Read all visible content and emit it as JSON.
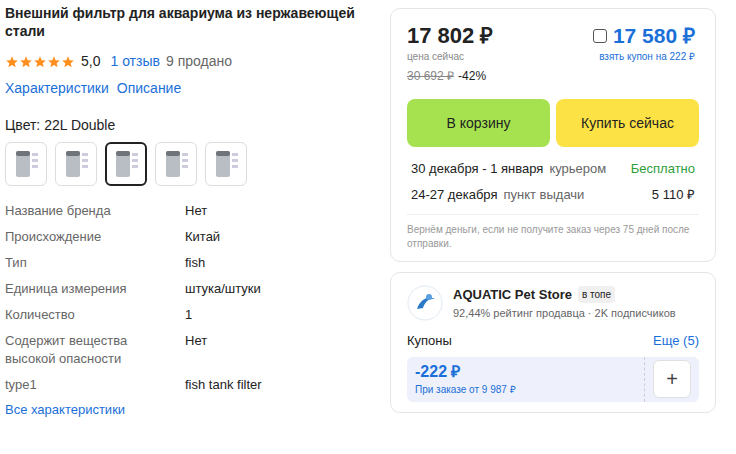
{
  "product": {
    "title": "Внешний фильтр для аквариума из нержавеющей стали",
    "stars": 5,
    "rating": "5,0",
    "reviews": "1 отзыв",
    "sold": "9 продано",
    "links": [
      "Характеристики",
      "Описание"
    ],
    "color_label": "Цвет: 22L Double",
    "thumbnails": [
      {
        "selected": false
      },
      {
        "selected": false
      },
      {
        "selected": true
      },
      {
        "selected": false
      },
      {
        "selected": false
      }
    ],
    "specs": [
      {
        "label": "Название бренда",
        "value": "Нет"
      },
      {
        "label": "Происхождение",
        "value": "Китай"
      },
      {
        "label": "Тип",
        "value": "fish"
      },
      {
        "label": "Единица измерения",
        "value": "штука/штуки"
      },
      {
        "label": "Количество",
        "value": "1"
      },
      {
        "label": "Содержит вещества высокой опасности",
        "value": "Нет"
      },
      {
        "label": "type1",
        "value": "fish tank filter"
      }
    ],
    "all_specs": "Все характеристики"
  },
  "price_card": {
    "price": "17 802 ₽",
    "price_caption": "цена сейчас",
    "old_price": "30 692 ₽",
    "discount": "-42%",
    "coupon_price": "17 580 ₽",
    "coupon_checked": false,
    "coupon_caption": "взять купон на 222 ₽",
    "buttons": [
      "В корзину",
      "Купить сейчас"
    ],
    "delivery": [
      {
        "dates": "30 декабря - 1 января",
        "method": "курьером",
        "price": "Бесплатно",
        "free": true
      },
      {
        "dates": "24-27 декабря",
        "method": "пункт выдачи",
        "price": "5 110 ₽",
        "free": false
      }
    ],
    "note": "Вернём деньги, если не получите заказ через 75 дней после отправки."
  },
  "seller": {
    "name": "AQUATIC Pet Store",
    "badge": "в топе",
    "stats": "92,44% рейтинг продавца · 2K подписчиков",
    "coupons_label": "Купоны",
    "more": "Еще (5)",
    "coupon": {
      "amount": "-222 ₽",
      "condition": "При заказе от 9 987 ₽",
      "add": "+"
    }
  }
}
